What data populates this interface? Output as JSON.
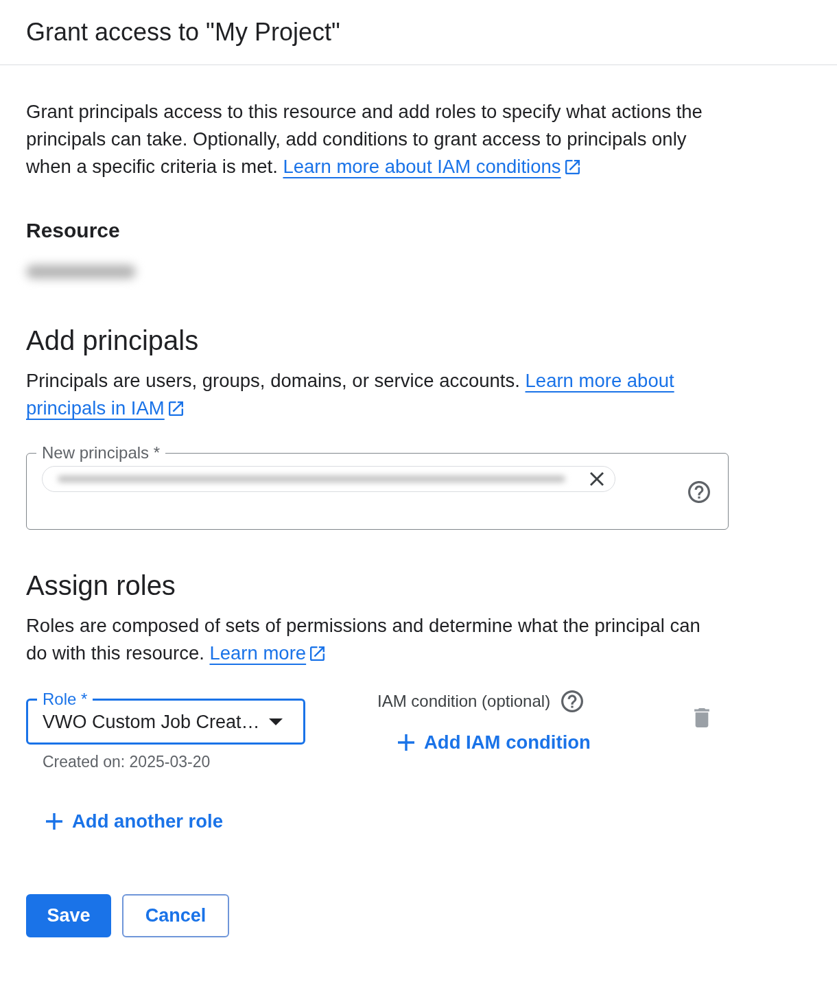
{
  "dialog": {
    "title": "Grant access to \"My Project\""
  },
  "intro": {
    "text": "Grant principals access to this resource and add roles to specify what actions the principals can take. Optionally, add conditions to grant access to principals only when a specific criteria is met.",
    "link_parts": [
      "Learn more about IAM conditions"
    ]
  },
  "resource": {
    "heading": "Resource",
    "value_blurred": true
  },
  "add_principals": {
    "heading": "Add principals",
    "text": "Principals are users, groups, domains, or service accounts.",
    "link_parts": [
      "Learn more about",
      "principals in IAM"
    ],
    "field": {
      "label": "New principals *",
      "chips": [
        {
          "blurred": true
        }
      ]
    }
  },
  "assign_roles": {
    "heading": "Assign roles",
    "text": "Roles are composed of sets of permissions and determine what the principal can do with this resource.",
    "link_parts": [
      "Learn more"
    ],
    "roles": [
      {
        "label": "Role *",
        "value": "VWO Custom Job Creat…",
        "focused": true,
        "helper": "Created on: 2025-03-20",
        "condition_label": "IAM condition (optional)",
        "add_condition": "Add IAM condition"
      }
    ],
    "add_role": "Add another role"
  },
  "buttons": [
    {
      "label": "Save",
      "kind": "primary"
    },
    {
      "label": "Cancel",
      "kind": "outlined"
    }
  ]
}
